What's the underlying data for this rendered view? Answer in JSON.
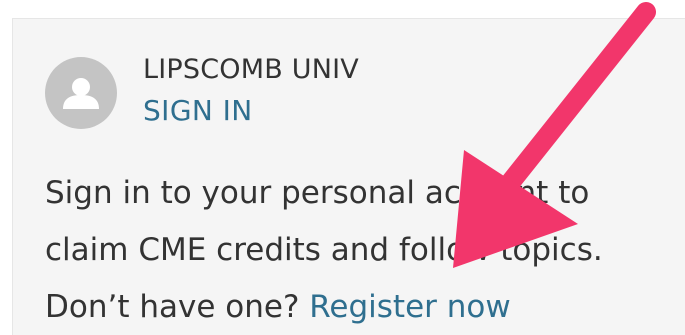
{
  "account": {
    "org_name": "LIPSCOMB UNIV",
    "sign_in_label": "SIGN IN",
    "avatar_icon": "user-avatar-icon"
  },
  "message": {
    "line1": "Sign in to your personal account to",
    "line2": "claim CME credits and follow topics.",
    "line3_prefix": "Don’t have one? ",
    "register_label": "Register now"
  },
  "annotation": {
    "arrow_color": "#f2366b",
    "arrow_icon": "arrow-annotation-icon"
  },
  "colors": {
    "link": "#2f6f8f",
    "text": "#333333",
    "panel_bg": "#f5f5f5",
    "avatar_bg": "#c4c4c4"
  }
}
